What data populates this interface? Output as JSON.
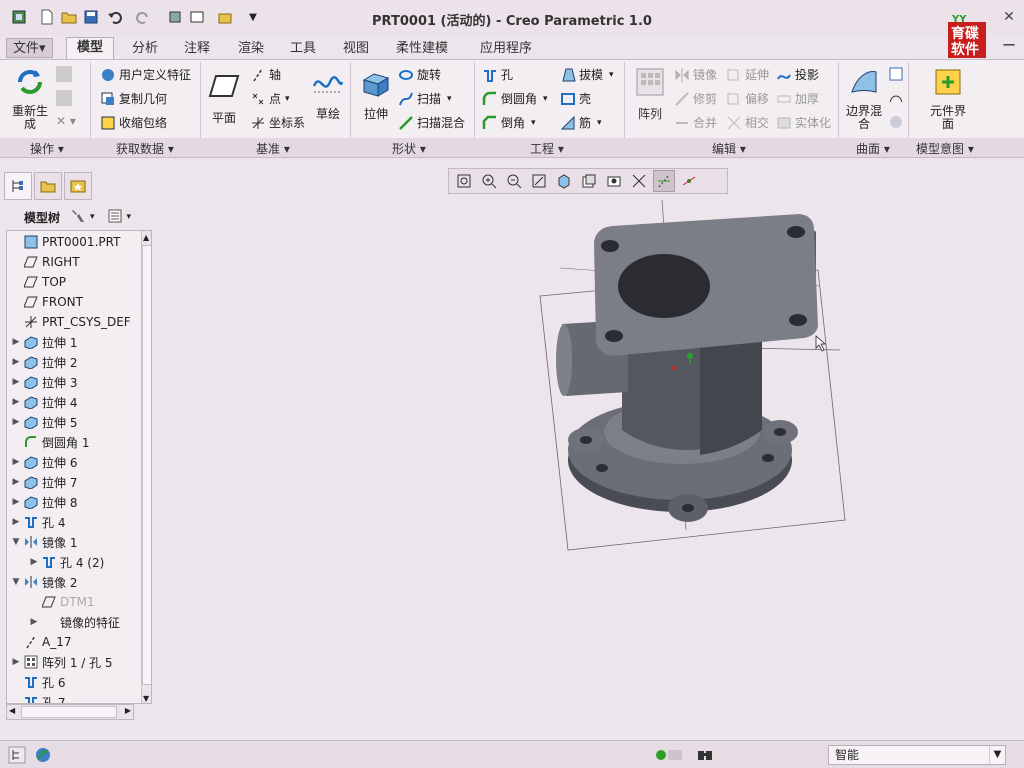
{
  "window": {
    "title": "PRT0001 (活动的) - Creo Parametric 1.0",
    "brand_text": "育碟软件"
  },
  "tabs": {
    "file": "文件▾",
    "items": [
      "模型",
      "分析",
      "注释",
      "渲染",
      "工具",
      "视图",
      "柔性建模",
      "应用程序"
    ]
  },
  "ribbon": {
    "regenerate": "重新生成",
    "udf": "用户定义特征",
    "copy_geom": "复制几何",
    "shrinkwrap": "收缩包络",
    "plane": "平面",
    "axis": "轴",
    "point": "点",
    "csys": "坐标系",
    "sketch": "草绘",
    "extrude": "拉伸",
    "revolve": "旋转",
    "sweep": "扫描",
    "swept_blend": "扫描混合",
    "hole": "孔",
    "round": "倒圆角",
    "chamfer": "倒角",
    "draft": "拔模",
    "shell": "壳",
    "rib": "筋",
    "pattern": "阵列",
    "mirror": "镜像",
    "trim": "修剪",
    "merge": "合并",
    "extend": "延伸",
    "offset": "偏移",
    "intersect": "相交",
    "project": "投影",
    "thicken": "加厚",
    "solidify": "实体化",
    "boundary_blend": "边界混合",
    "component_interface": "元件界面",
    "groups": [
      "操作",
      "获取数据",
      "基准",
      "形状",
      "工程",
      "编辑",
      "曲面",
      "模型意图"
    ]
  },
  "model_tree": {
    "title": "模型树",
    "items": [
      {
        "label": "PRT0001.PRT",
        "icon": "part-icon",
        "expand": ""
      },
      {
        "label": "RIGHT",
        "icon": "datum-plane-icon",
        "expand": ""
      },
      {
        "label": "TOP",
        "icon": "datum-plane-icon",
        "expand": ""
      },
      {
        "label": "FRONT",
        "icon": "datum-plane-icon",
        "expand": ""
      },
      {
        "label": "PRT_CSYS_DEF",
        "icon": "csys-icon",
        "expand": ""
      },
      {
        "label": "拉伸 1",
        "icon": "extrude-icon",
        "expand": "▶"
      },
      {
        "label": "拉伸 2",
        "icon": "extrude-icon",
        "expand": "▶"
      },
      {
        "label": "拉伸 3",
        "icon": "extrude-icon",
        "expand": "▶"
      },
      {
        "label": "拉伸 4",
        "icon": "extrude-icon",
        "expand": "▶"
      },
      {
        "label": "拉伸 5",
        "icon": "extrude-icon",
        "expand": "▶"
      },
      {
        "label": "倒圆角 1",
        "icon": "round-icon",
        "expand": ""
      },
      {
        "label": "拉伸 6",
        "icon": "extrude-icon",
        "expand": "▶"
      },
      {
        "label": "拉伸 7",
        "icon": "extrude-icon",
        "expand": "▶"
      },
      {
        "label": "拉伸 8",
        "icon": "extrude-icon",
        "expand": "▶"
      },
      {
        "label": "孔 4",
        "icon": "hole-icon",
        "expand": "▶"
      },
      {
        "label": "镜像 1",
        "icon": "mirror-icon",
        "expand": "▼"
      },
      {
        "label": "孔 4 (2)",
        "icon": "hole-icon",
        "expand": "▶",
        "indent": 1
      },
      {
        "label": "镜像 2",
        "icon": "mirror-icon",
        "expand": "▼"
      },
      {
        "label": "DTM1",
        "icon": "datum-plane-icon",
        "expand": "",
        "indent": 1,
        "dim": true
      },
      {
        "label": "镜像的特征",
        "icon": "",
        "expand": "▶",
        "indent": 1
      },
      {
        "label": "A_17",
        "icon": "axis-icon",
        "expand": ""
      },
      {
        "label": "阵列 1 / 孔 5",
        "icon": "pattern-icon",
        "expand": "▶"
      },
      {
        "label": "孔 6",
        "icon": "hole-icon",
        "expand": ""
      },
      {
        "label": "孔 7",
        "icon": "hole-icon",
        "expand": ""
      }
    ]
  },
  "status": {
    "filter": "智能"
  },
  "colors": {
    "background": "#ede5ec",
    "model": "#5c5e68",
    "accent_green": "#2aa02a"
  }
}
